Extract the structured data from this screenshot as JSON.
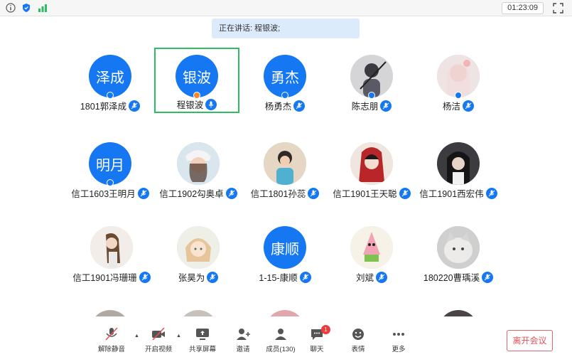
{
  "topbar": {
    "timer": "01:23:09",
    "icons": [
      "info-icon",
      "shield-icon",
      "signal-icon",
      "fullscreen-icon"
    ]
  },
  "speaking": {
    "text": "正在讲话: 程银波;"
  },
  "participants": [
    {
      "avatar_text": "泽成",
      "name": "1801郭泽成"
    },
    {
      "avatar_text": "银波",
      "name": "程银波",
      "active": true,
      "host": true
    },
    {
      "avatar_text": "勇杰",
      "name": "杨勇杰"
    },
    {
      "avatar_text": "",
      "name": "陈志朋"
    },
    {
      "avatar_text": "",
      "name": "杨洁"
    },
    {
      "avatar_text": "明月",
      "name": "信工1603王明月"
    },
    {
      "avatar_text": "",
      "name": "信工1902勾奥卓"
    },
    {
      "avatar_text": "",
      "name": "信工1801孙蕊"
    },
    {
      "avatar_text": "",
      "name": "信工1901王天聪"
    },
    {
      "avatar_text": "",
      "name": "信工1901西宏伟"
    },
    {
      "avatar_text": "",
      "name": "信工1901冯珊珊"
    },
    {
      "avatar_text": "",
      "name": "张昊为"
    },
    {
      "avatar_text": "康顺",
      "name": "1-15-康顺"
    },
    {
      "avatar_text": "",
      "name": "刘斌"
    },
    {
      "avatar_text": "",
      "name": "180220曹瑀溪"
    }
  ],
  "toolbar": {
    "unmute": "解除静音",
    "video": "开启视频",
    "share": "共享屏幕",
    "invite": "邀请",
    "members": "成员(130)",
    "chat": "聊天",
    "chat_badge": "1",
    "reactions": "表情",
    "more": "更多",
    "leave": "离开会议"
  },
  "colors": {
    "accent": "#1677f2",
    "active_border": "#2dbd62",
    "leave": "#e3545a"
  }
}
